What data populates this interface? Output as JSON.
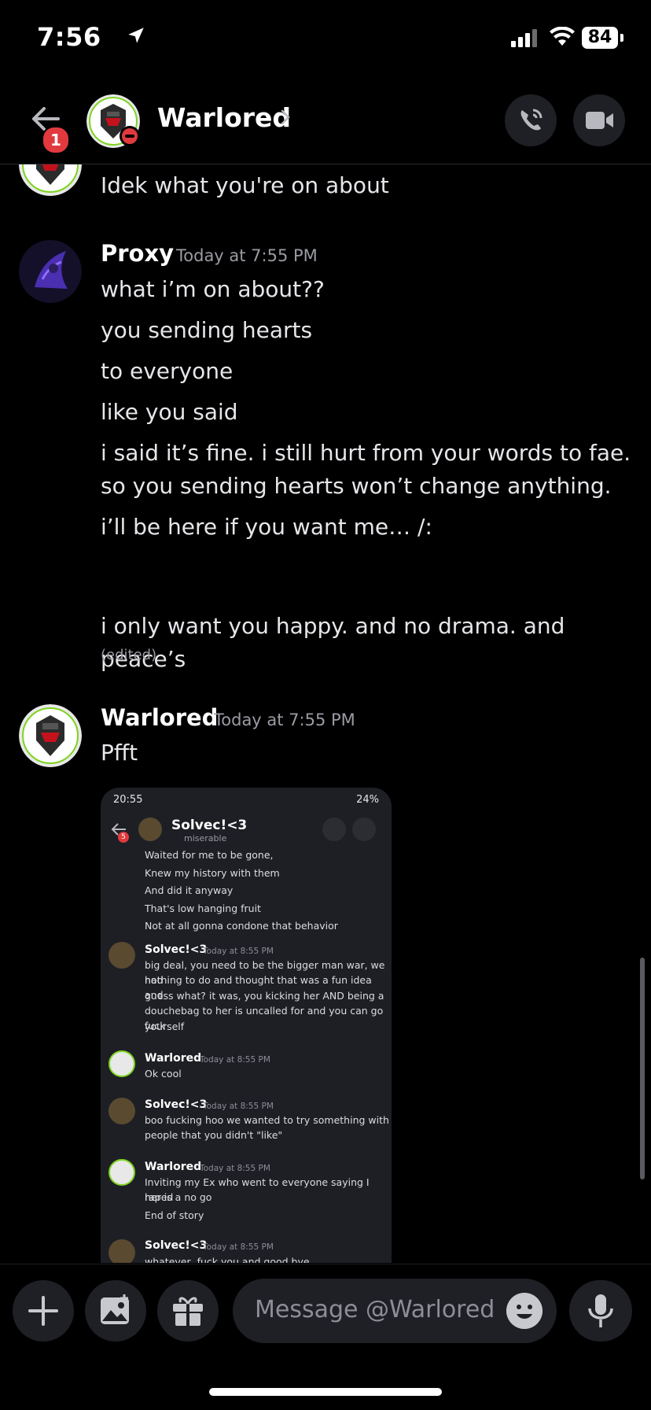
{
  "status_bar": {
    "time": "7:56",
    "battery": "84"
  },
  "header": {
    "contact_name": "Warlored",
    "unread_badge": "1"
  },
  "messages": [
    {
      "text": "Idek what you're on about"
    },
    {
      "author": "Proxy",
      "timestamp": "Today at 7:55 PM",
      "lines": [
        "what i’m on about??",
        "you sending hearts",
        "to everyone",
        "like you said",
        "i said it’s fine. i still hurt from your words to fae.",
        "so you sending hearts won’t change anything.",
        "i’ll be here if you want me… /:",
        "i only want you happy. and no drama. and peace’s"
      ],
      "edited": "(edited)"
    },
    {
      "author": "Warlored",
      "timestamp": "Today at 7:55 PM",
      "text": "Pfft"
    }
  ],
  "screenshot": {
    "status_time": "20:55",
    "status_battery": "24%",
    "contact_name": "Solvec!<3",
    "contact_status": "miserable",
    "badge": "5",
    "lines_top": [
      "Waited for me to be gone,",
      "Knew my history with them",
      "And did it anyway",
      "That's low hanging fruit",
      "Not at all gonna condone that behavior"
    ],
    "messages": [
      {
        "author": "Solvec!<3",
        "timestamp": "Today at 8:55 PM",
        "lines": [
          "big deal, you need to be the bigger man war, we had",
          "nothing to do and thought that was a fun idea and",
          "guess what? it was, you kicking her AND being a",
          "douchebag to her is uncalled for and you can go fuck",
          "yourself"
        ]
      },
      {
        "author": "Warlored",
        "timestamp": "Today at 8:55 PM",
        "lines": [
          "Ok cool"
        ]
      },
      {
        "author": "Solvec!<3",
        "timestamp": "Today at 8:55 PM",
        "lines": [
          "boo fucking hoo we wanted to try something with",
          "people that you didn't \"like\""
        ]
      },
      {
        "author": "Warlored",
        "timestamp": "Today at 8:55 PM",
        "lines": [
          "Inviting my Ex who went to everyone saying I raped",
          "her is a no go",
          "End of story"
        ]
      },
      {
        "author": "Solvec!<3",
        "timestamp": "Today at 8:55 PM",
        "lines": [
          "whatever, fuck you and good bye"
        ]
      }
    ]
  },
  "composer": {
    "placeholder": "Message @Warlored"
  },
  "colors": {
    "background": "#000000",
    "surface": "#1f2025",
    "dnd_red": "#e03a3e",
    "online_green": "#3ba55d"
  },
  "icons": [
    "location-arrow-icon",
    "signal-icon",
    "wifi-icon",
    "battery-icon",
    "back-arrow-icon",
    "chevron-right-icon",
    "phone-call-icon",
    "video-camera-icon",
    "plus-icon",
    "image-icon",
    "gift-icon",
    "emoji-icon",
    "microphone-icon"
  ]
}
